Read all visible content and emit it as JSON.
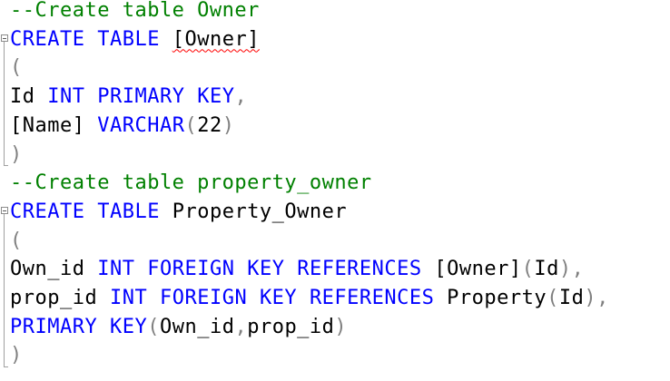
{
  "editor": {
    "lines": [
      {
        "tokens": [
          {
            "t": "--Create table Owner",
            "c": "cm"
          }
        ]
      },
      {
        "tokens": [
          {
            "t": "CREATE",
            "c": "kw"
          },
          {
            "t": " ",
            "c": "id"
          },
          {
            "t": "TABLE",
            "c": "kw"
          },
          {
            "t": " ",
            "c": "id"
          },
          {
            "t": "[Owner]",
            "c": "id",
            "err": true
          }
        ]
      },
      {
        "tokens": [
          {
            "t": "(",
            "c": "pn"
          }
        ]
      },
      {
        "tokens": [
          {
            "t": "Id",
            "c": "id"
          },
          {
            "t": " ",
            "c": "id"
          },
          {
            "t": "INT",
            "c": "kw"
          },
          {
            "t": " ",
            "c": "id"
          },
          {
            "t": "PRIMARY",
            "c": "kw"
          },
          {
            "t": " ",
            "c": "id"
          },
          {
            "t": "KEY",
            "c": "kw"
          },
          {
            "t": ",",
            "c": "pn"
          }
        ]
      },
      {
        "tokens": [
          {
            "t": "[Name]",
            "c": "id"
          },
          {
            "t": " ",
            "c": "id"
          },
          {
            "t": "VARCHAR",
            "c": "kw"
          },
          {
            "t": "(",
            "c": "pn"
          },
          {
            "t": "22",
            "c": "id"
          },
          {
            "t": ")",
            "c": "pn"
          }
        ]
      },
      {
        "tokens": [
          {
            "t": ")",
            "c": "pn"
          }
        ]
      },
      {
        "tokens": [
          {
            "t": "--Create table property_owner",
            "c": "cm"
          }
        ]
      },
      {
        "tokens": [
          {
            "t": "CREATE",
            "c": "kw"
          },
          {
            "t": " ",
            "c": "id"
          },
          {
            "t": "TABLE",
            "c": "kw"
          },
          {
            "t": " ",
            "c": "id"
          },
          {
            "t": "Property_Owner",
            "c": "id"
          }
        ]
      },
      {
        "tokens": [
          {
            "t": "(",
            "c": "pn"
          }
        ]
      },
      {
        "tokens": [
          {
            "t": "Own_id",
            "c": "id"
          },
          {
            "t": " ",
            "c": "id"
          },
          {
            "t": "INT",
            "c": "kw"
          },
          {
            "t": " ",
            "c": "id"
          },
          {
            "t": "FOREIGN",
            "c": "kw"
          },
          {
            "t": " ",
            "c": "id"
          },
          {
            "t": "KEY",
            "c": "kw"
          },
          {
            "t": " ",
            "c": "id"
          },
          {
            "t": "REFERENCES",
            "c": "kw"
          },
          {
            "t": " ",
            "c": "id"
          },
          {
            "t": "[Owner]",
            "c": "id"
          },
          {
            "t": "(",
            "c": "pn"
          },
          {
            "t": "Id",
            "c": "id"
          },
          {
            "t": "),",
            "c": "pn"
          }
        ]
      },
      {
        "tokens": [
          {
            "t": "prop_id",
            "c": "id"
          },
          {
            "t": " ",
            "c": "id"
          },
          {
            "t": "INT",
            "c": "kw"
          },
          {
            "t": " ",
            "c": "id"
          },
          {
            "t": "FOREIGN",
            "c": "kw"
          },
          {
            "t": " ",
            "c": "id"
          },
          {
            "t": "KEY",
            "c": "kw"
          },
          {
            "t": " ",
            "c": "id"
          },
          {
            "t": "REFERENCES",
            "c": "kw"
          },
          {
            "t": " ",
            "c": "id"
          },
          {
            "t": "Property",
            "c": "id"
          },
          {
            "t": "(",
            "c": "pn"
          },
          {
            "t": "Id",
            "c": "id"
          },
          {
            "t": "),",
            "c": "pn"
          }
        ]
      },
      {
        "tokens": [
          {
            "t": "PRIMARY",
            "c": "kw"
          },
          {
            "t": " ",
            "c": "id"
          },
          {
            "t": "KEY",
            "c": "kw"
          },
          {
            "t": "(",
            "c": "pn"
          },
          {
            "t": "Own_id",
            "c": "id"
          },
          {
            "t": ",",
            "c": "pn"
          },
          {
            "t": "prop_id",
            "c": "id"
          },
          {
            "t": ")",
            "c": "pn"
          }
        ]
      },
      {
        "tokens": [
          {
            "t": ")",
            "c": "pn"
          }
        ]
      }
    ]
  },
  "colors": {
    "comment": "#008000",
    "keyword": "#0000ff",
    "identifier": "#000000",
    "punctuation": "#808080",
    "error_squiggle": "#ff0000"
  }
}
